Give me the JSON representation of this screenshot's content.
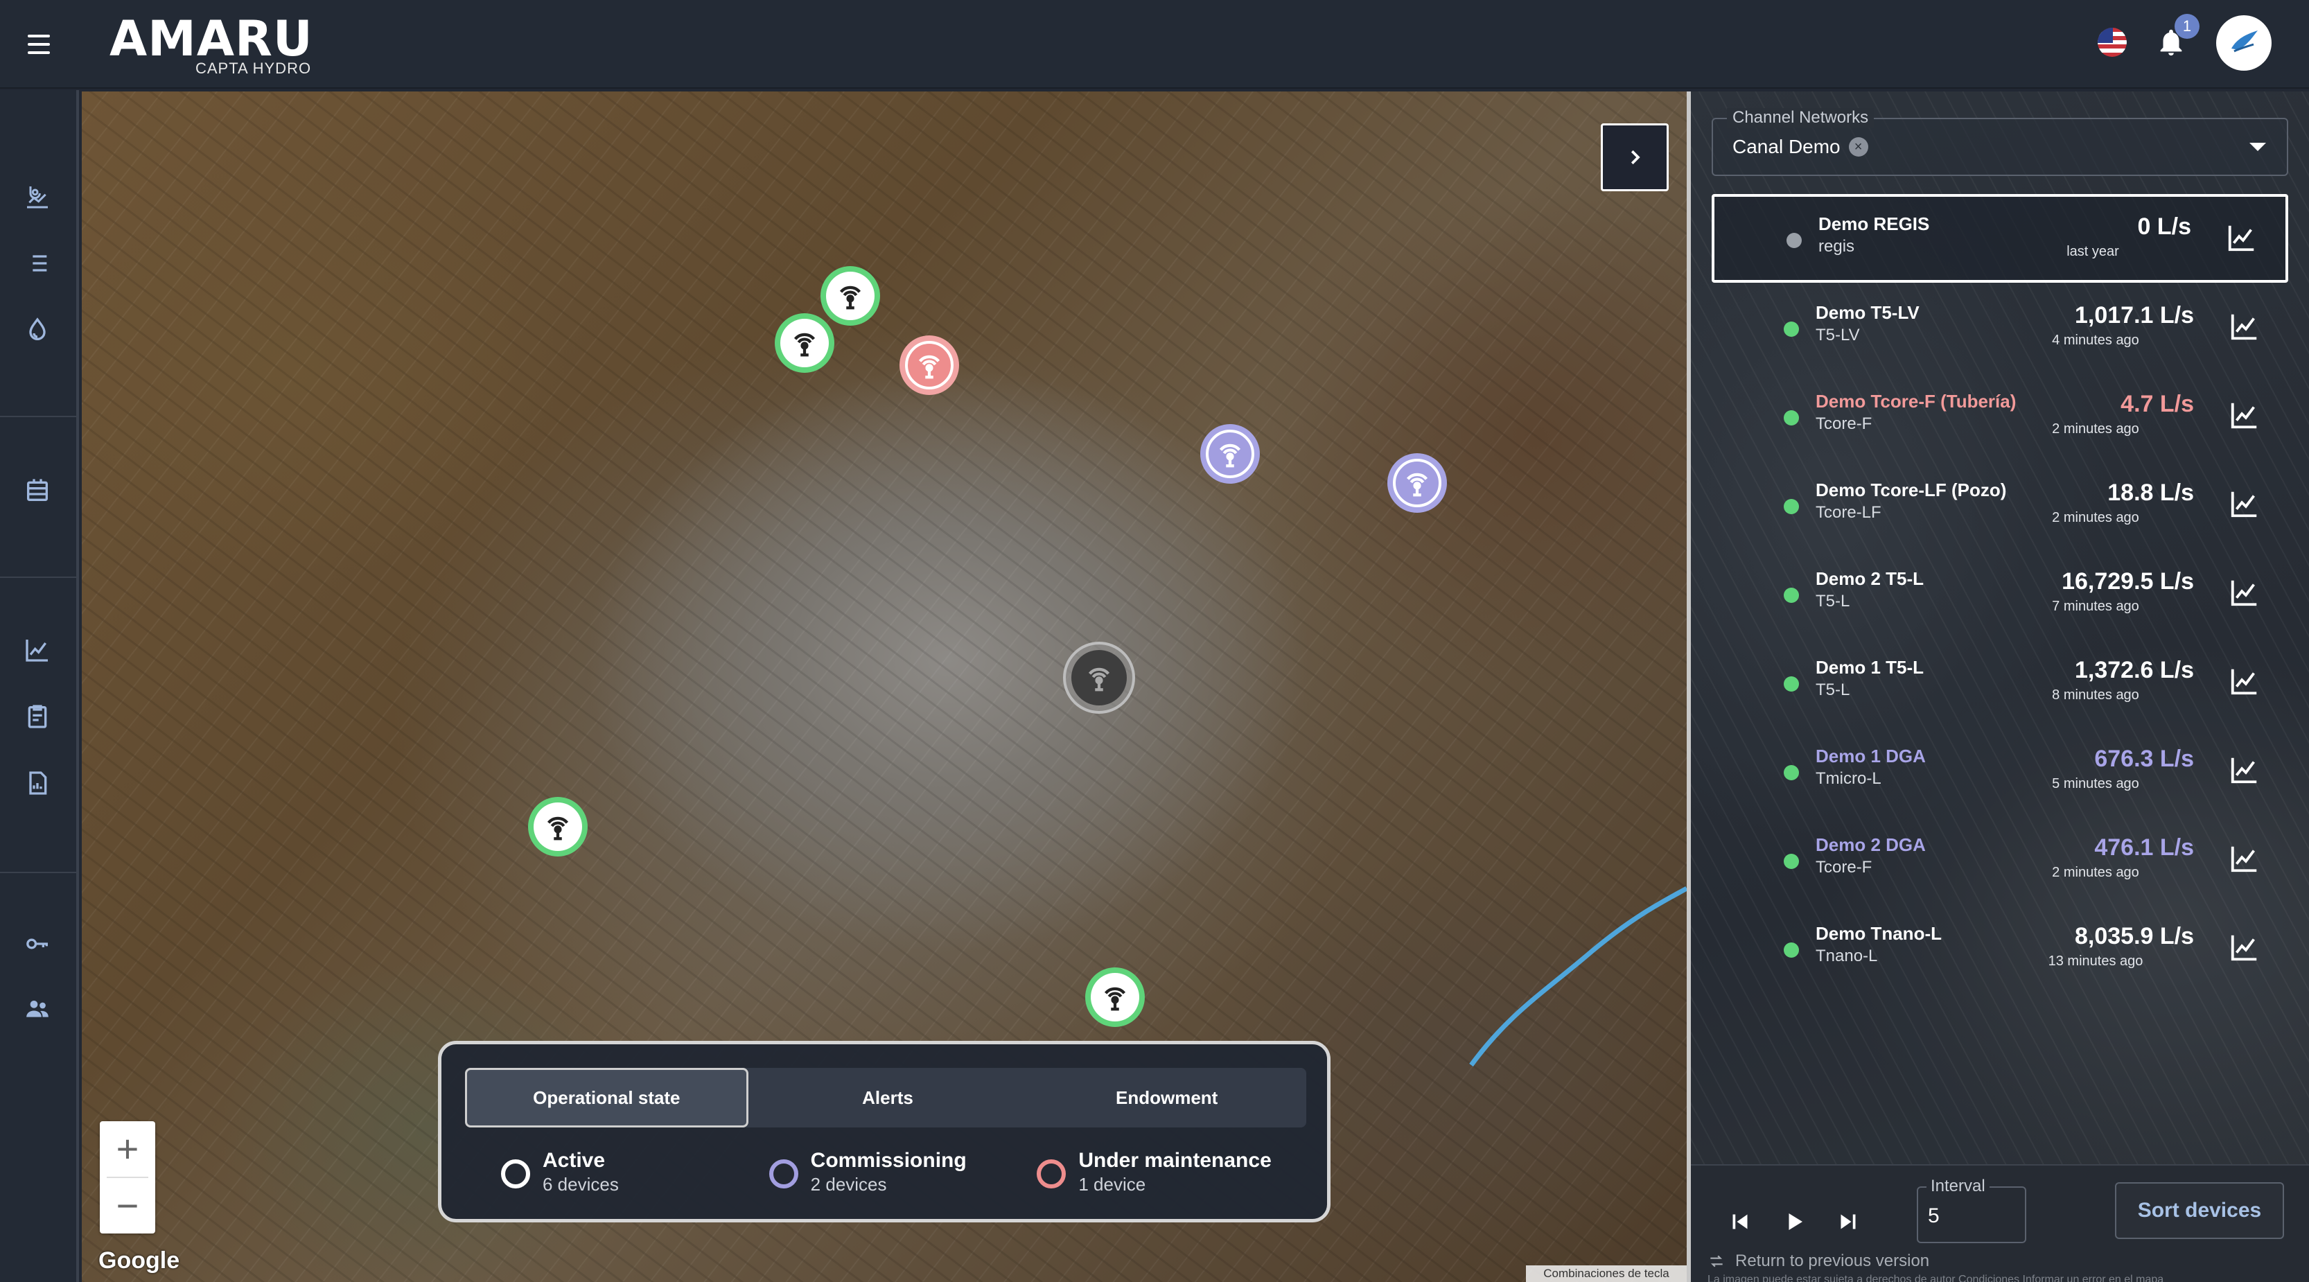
{
  "header": {
    "brand": "AMARU",
    "subtitle": "CAPTA HYDRO",
    "notification_count": "1"
  },
  "sidebar": {
    "items": [
      {
        "icon": "map-pin-chart-icon"
      },
      {
        "icon": "list-icon"
      },
      {
        "icon": "water-drop-icon"
      },
      {
        "icon": "device-stack-icon"
      },
      {
        "icon": "line-chart-icon"
      },
      {
        "icon": "clipboard-report-icon"
      },
      {
        "icon": "document-chart-icon"
      },
      {
        "icon": "key-icon"
      },
      {
        "icon": "users-icon"
      }
    ]
  },
  "map": {
    "attribution": "Google",
    "keyboard_shortcuts": "Combinaciones de tecla",
    "zoom_in": "+",
    "zoom_out": "−",
    "markers": [
      {
        "state": "active",
        "color": "#5fd47a"
      },
      {
        "state": "active",
        "color": "#5fd47a"
      },
      {
        "state": "maintenance",
        "color": "#ee8d8d"
      },
      {
        "state": "commissioning",
        "color": "#a29ee0"
      },
      {
        "state": "commissioning",
        "color": "#a29ee0"
      },
      {
        "state": "selected",
        "color": "#3e3e3e"
      },
      {
        "state": "active",
        "color": "#5fd47a"
      },
      {
        "state": "active",
        "color": "#5fd47a"
      }
    ]
  },
  "legend": {
    "tabs": [
      "Operational state",
      "Alerts",
      "Endowment"
    ],
    "active_tab": "Operational state",
    "items": [
      {
        "name": "Active",
        "count": "6 devices",
        "color": "#ffffff"
      },
      {
        "name": "Commissioning",
        "count": "2 devices",
        "color": "#a29ee0"
      },
      {
        "name": "Under maintenance",
        "count": "1 device",
        "color": "#ee8d8d"
      }
    ]
  },
  "panel": {
    "channel_label": "Channel Networks",
    "channel_value": "Canal Demo",
    "devices": [
      {
        "title": "Demo REGIS",
        "model": "regis",
        "flow": "0 L/s",
        "ago": "last year",
        "status_color": "#9aa0a8",
        "title_color": "#ffffff",
        "flow_color": "#ffffff",
        "selected": true
      },
      {
        "title": "Demo T5-LV",
        "model": "T5-LV",
        "flow": "1,017.1 L/s",
        "ago": "4 minutes ago",
        "status_color": "#5fd47a",
        "title_color": "#ffffff",
        "flow_color": "#ffffff"
      },
      {
        "title": "Demo Tcore-F (Tubería)",
        "model": "Tcore-F",
        "flow": "4.7 L/s",
        "ago": "2 minutes ago",
        "status_color": "#5fd47a",
        "title_color": "#f29a9a",
        "flow_color": "#f29a9a"
      },
      {
        "title": "Demo Tcore-LF (Pozo)",
        "model": "Tcore-LF",
        "flow": "18.8 L/s",
        "ago": "2 minutes ago",
        "status_color": "#5fd47a",
        "title_color": "#ffffff",
        "flow_color": "#ffffff"
      },
      {
        "title": "Demo 2 T5-L",
        "model": "T5-L",
        "flow": "16,729.5 L/s",
        "ago": "7 minutes ago",
        "status_color": "#5fd47a",
        "title_color": "#ffffff",
        "flow_color": "#ffffff"
      },
      {
        "title": "Demo 1 T5-L",
        "model": "T5-L",
        "flow": "1,372.6 L/s",
        "ago": "8 minutes ago",
        "status_color": "#5fd47a",
        "title_color": "#ffffff",
        "flow_color": "#ffffff"
      },
      {
        "title": "Demo 1 DGA",
        "model": "Tmicro-L",
        "flow": "676.3 L/s",
        "ago": "5 minutes ago",
        "status_color": "#5fd47a",
        "title_color": "#a9a5e8",
        "flow_color": "#a9a5e8"
      },
      {
        "title": "Demo 2 DGA",
        "model": "Tcore-F",
        "flow": "476.1 L/s",
        "ago": "2 minutes ago",
        "status_color": "#5fd47a",
        "title_color": "#a9a5e8",
        "flow_color": "#a9a5e8"
      },
      {
        "title": "Demo Tnano-L",
        "model": "Tnano-L",
        "flow": "8,035.9 L/s",
        "ago": "13 minutes ago",
        "status_color": "#5fd47a",
        "title_color": "#ffffff",
        "flow_color": "#ffffff"
      }
    ],
    "interval_label": "Interval",
    "interval_value": "5",
    "sort_label": "Sort devices",
    "return_label": "Return to previous version",
    "legal": "La imagen puede estar sujeta a derechos de autor    Condiciones    Informar un error en el mapa"
  }
}
